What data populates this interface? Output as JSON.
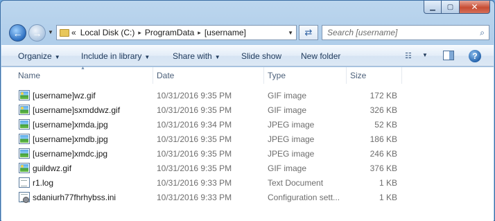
{
  "window": {
    "caption_buttons": {
      "minimize": "▁",
      "maximize": "▢",
      "close": "✕"
    }
  },
  "nav": {
    "back_icon": "arrow-left-icon",
    "forward_icon": "arrow-right-icon",
    "address": {
      "overflow": "«",
      "segments": [
        "Local Disk (C:)",
        "ProgramData",
        "[username]"
      ],
      "separator": "▸"
    },
    "search_placeholder": "Search [username]"
  },
  "toolbar": {
    "organize": "Organize",
    "include": "Include in library",
    "share": "Share with",
    "slideshow": "Slide show",
    "new_folder": "New folder",
    "help": "?"
  },
  "columns": {
    "name": "Name",
    "date": "Date",
    "type": "Type",
    "size": "Size"
  },
  "files": [
    {
      "name": "[username]wz.gif",
      "date": "10/31/2016 9:35 PM",
      "type": "GIF image",
      "size": "172 KB",
      "icon": "gif"
    },
    {
      "name": "[username]sxmddwz.gif",
      "date": "10/31/2016 9:35 PM",
      "type": "GIF image",
      "size": "326 KB",
      "icon": "gif"
    },
    {
      "name": "[username]xmda.jpg",
      "date": "10/31/2016 9:34 PM",
      "type": "JPEG image",
      "size": "52 KB",
      "icon": "jpg"
    },
    {
      "name": "[username]xmdb.jpg",
      "date": "10/31/2016 9:35 PM",
      "type": "JPEG image",
      "size": "186 KB",
      "icon": "jpg"
    },
    {
      "name": "[username]xmdc.jpg",
      "date": "10/31/2016 9:35 PM",
      "type": "JPEG image",
      "size": "246 KB",
      "icon": "jpg"
    },
    {
      "name": "guildwz.gif",
      "date": "10/31/2016 9:35 PM",
      "type": "GIF image",
      "size": "376 KB",
      "icon": "gif"
    },
    {
      "name": "r1.log",
      "date": "10/31/2016 9:33 PM",
      "type": "Text Document",
      "size": "1 KB",
      "icon": "txt"
    },
    {
      "name": "sdaniurh77fhrhybss.ini",
      "date": "10/31/2016 9:33 PM",
      "type": "Configuration sett...",
      "size": "1 KB",
      "icon": "ini"
    }
  ]
}
